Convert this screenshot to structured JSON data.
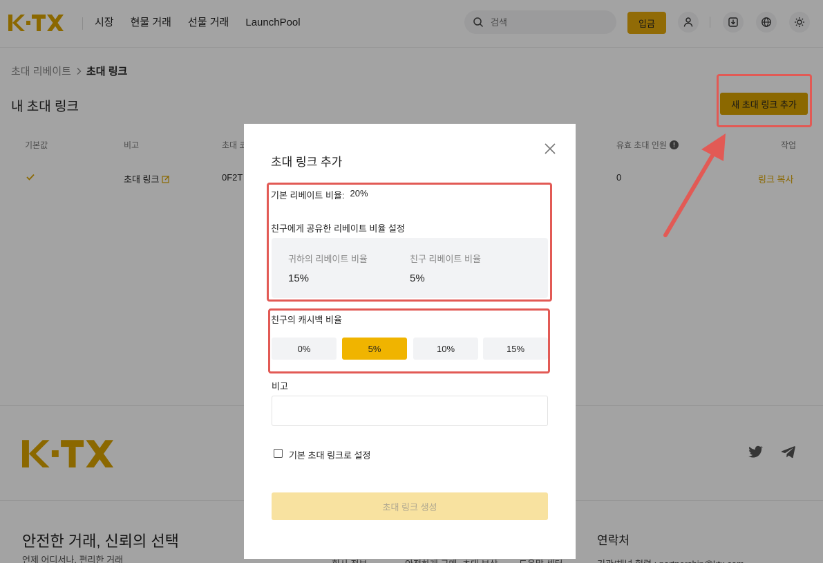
{
  "header": {
    "nav": [
      "시장",
      "현물 거래",
      "선물 거래",
      "LaunchPool"
    ],
    "search_placeholder": "검색",
    "deposit_label": "입금"
  },
  "breadcrumb": {
    "parent": "초대 리베이트",
    "current": "초대 링크"
  },
  "page_title": "내 초대 링크",
  "add_button_label": "새 초대 링크 추가",
  "table": {
    "headers": [
      "기본값",
      "비고",
      "초대 코",
      "유효 초대 인원",
      "작업"
    ],
    "row": {
      "note": "초대 링크",
      "code": "0F2T",
      "count": "0",
      "action": "링크 복사"
    }
  },
  "footer": {
    "title": "안전한 거래, 신뢰의 선택",
    "subtitle": "언제 어디서나, 편리한 거래",
    "contact_title": "연락처",
    "cut_links": [
      "회사 정보",
      "안정하게 구매",
      "초대 보상",
      "도움말 센터"
    ],
    "contact_cut": "기관/채널 협력 : partnership@ktx.com"
  },
  "modal": {
    "title": "초대 링크 추가",
    "base_rate_label": "기본 리베이트 비율:",
    "base_rate_value": "20%",
    "share_section_label": "친구에게 공유한 리베이트 비율 설정",
    "your_rate_label": "귀하의 리베이트 비율",
    "your_rate_value": "15%",
    "friend_rate_label": "친구 리베이트 비율",
    "friend_rate_value": "5%",
    "cashback_label": "친구의 캐시백 비율",
    "cashback_options": [
      "0%",
      "5%",
      "10%",
      "15%"
    ],
    "cashback_selected": "5%",
    "note_label": "비고",
    "default_checkbox_label": "기본 초대 링크로 설정",
    "create_button_label": "초대 링크 생성"
  },
  "colors": {
    "brand": "#d9a300",
    "selected_option": "#f0b400",
    "highlight": "#e25a55"
  }
}
